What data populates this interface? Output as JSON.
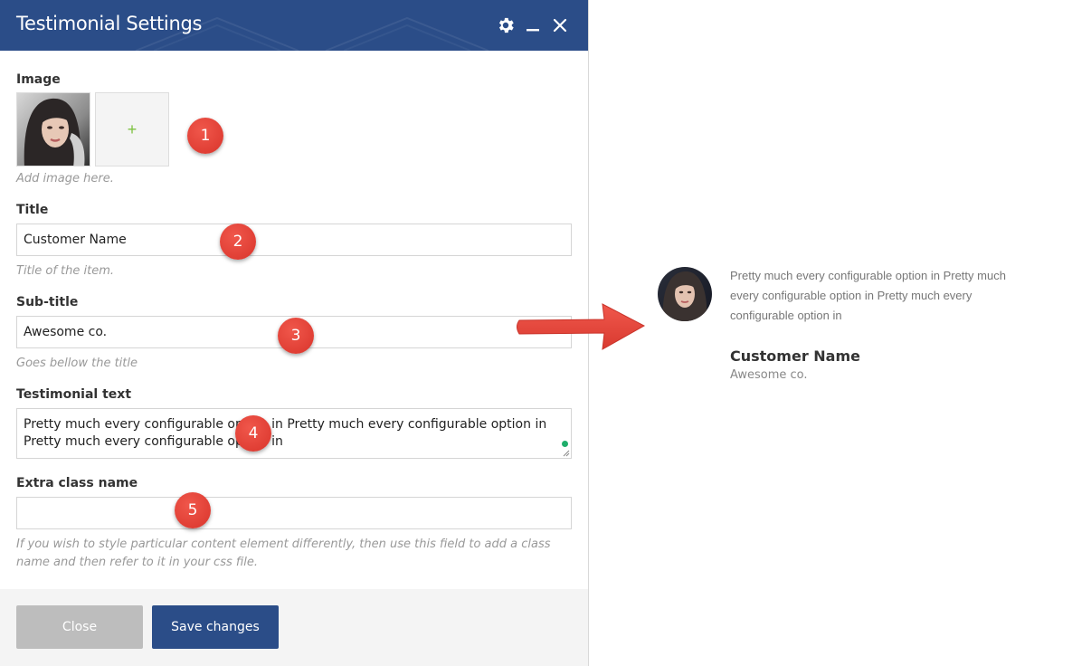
{
  "dialog": {
    "title": "Testimonial Settings",
    "icons": {
      "settings": "gear-icon",
      "minimize": "minimize-icon",
      "close": "close-icon"
    }
  },
  "fields": {
    "image": {
      "label": "Image",
      "hint": "Add image here.",
      "add_symbol": "+"
    },
    "title": {
      "label": "Title",
      "value": "Customer Name",
      "hint": "Title of the item."
    },
    "subtitle": {
      "label": "Sub-title",
      "value": "Awesome co.",
      "hint": "Goes bellow the title"
    },
    "testimonial": {
      "label": "Testimonial text",
      "value": "Pretty much every configurable option in Pretty much every configurable option in Pretty much every configurable option in"
    },
    "extra_class": {
      "label": "Extra class name",
      "value": "",
      "hint": "If you wish to style particular content element differently, then use this field to add a class name and then refer to it in your css file."
    }
  },
  "buttons": {
    "close": "Close",
    "save": "Save changes"
  },
  "callouts": [
    "1",
    "2",
    "3",
    "4",
    "5"
  ],
  "preview": {
    "quote": "Pretty much every configurable option in Pretty much every configurable option in Pretty much every configurable option in",
    "name": "Customer Name",
    "company": "Awesome co."
  },
  "colors": {
    "header": "#2b4d88",
    "save_button": "#2b4d88",
    "close_button": "#bdbdbd",
    "callout": "#e5453b",
    "plus": "#7dc241"
  }
}
